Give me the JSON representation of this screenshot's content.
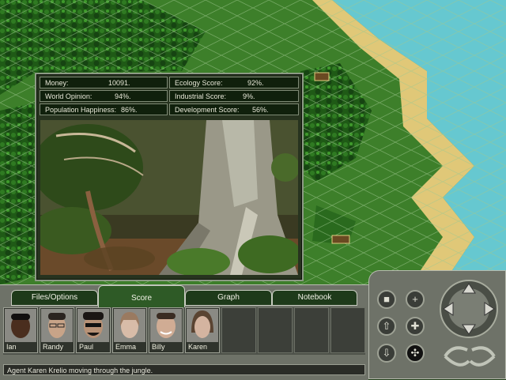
{
  "stats": {
    "money": {
      "label": "Money:",
      "value": "10091."
    },
    "world_opinion": {
      "label": "World Opinion:",
      "value": "94%."
    },
    "population_happiness": {
      "label": "Population Happiness:",
      "value": "86%."
    },
    "ecology_score": {
      "label": "Ecology Score:",
      "value": "92%."
    },
    "industrial_score": {
      "label": "Industrial Score:",
      "value": "9%."
    },
    "development_score": {
      "label": "Development Score:",
      "value": "56%."
    }
  },
  "tabs": [
    {
      "label": "Files/Options",
      "active": false
    },
    {
      "label": "Score",
      "active": true
    },
    {
      "label": "Graph",
      "active": false
    },
    {
      "label": "Notebook",
      "active": false
    }
  ],
  "agents": [
    {
      "name": "Ian",
      "skin": "#4a2e1e",
      "hair": "#121010"
    },
    {
      "name": "Randy",
      "skin": "#c8a488",
      "hair": "#2a2420"
    },
    {
      "name": "Paul",
      "skin": "#b89276",
      "hair": "#1a1614"
    },
    {
      "name": "Emma",
      "skin": "#d8bca8",
      "hair": "#9a7a60"
    },
    {
      "name": "Billy",
      "skin": "#d0ac94",
      "hair": "#3a2c22"
    },
    {
      "name": "Karen",
      "skin": "#d4b4a0",
      "hair": "#5a4432"
    }
  ],
  "status_text": "Agent Karen Krelio moving through the jungle.",
  "colors": {
    "water": "#66c8d0",
    "sand": "#e0c878",
    "grass": "#3e8a2a",
    "panel_bg": "#27331f"
  },
  "icons": [
    "square-icon",
    "plus-icon",
    "up-arrow-icon",
    "move-icon",
    "down-arrow-icon",
    "rotate-icon",
    "compass-icon"
  ]
}
